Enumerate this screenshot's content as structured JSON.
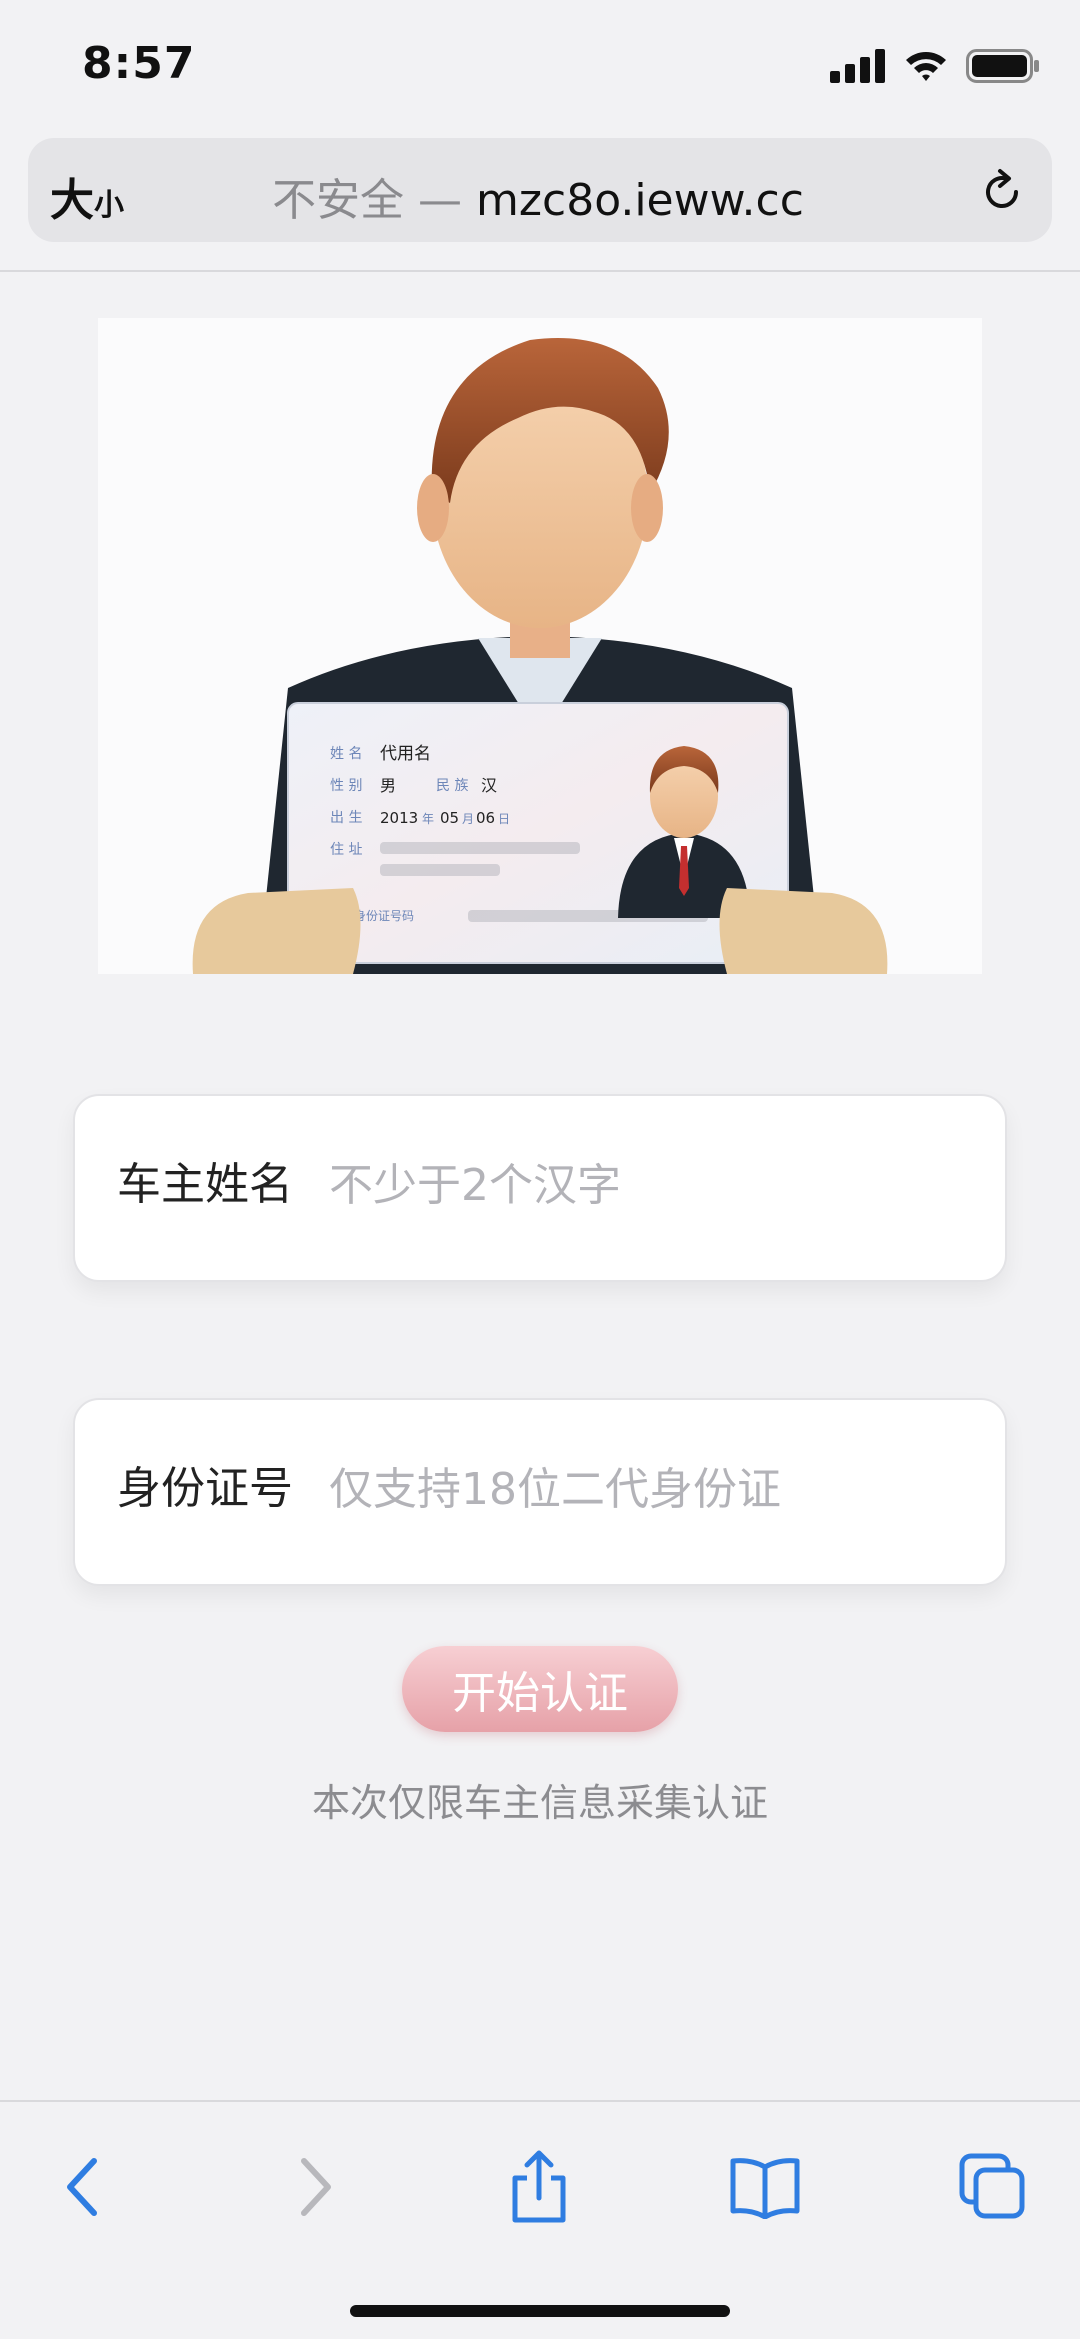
{
  "status_bar": {
    "time": "8:57"
  },
  "browser": {
    "text_size_large": "大",
    "text_size_small": "小",
    "security_label": "不安全",
    "separator": " — ",
    "domain": "mzc8o.ieww.cc"
  },
  "hero": {
    "card_name_label": "姓 名",
    "card_name_value": "代用名",
    "card_sex_label": "性 别",
    "card_sex_value": "男",
    "card_nation_label": "民 族",
    "card_nation_value": "汉",
    "card_birth_label": "出 生",
    "card_birth_year": "2013",
    "card_birth_year_unit": "年",
    "card_birth_month": "05",
    "card_birth_month_unit": "月",
    "card_birth_day": "06",
    "card_birth_day_unit": "日",
    "card_address_label": "住 址",
    "card_id_label": "公民身份证号码"
  },
  "form": {
    "name_label": "车主姓名",
    "name_placeholder": "不少于2个汉字",
    "id_label": "身份证号",
    "id_placeholder": "仅支持18位二代身份证",
    "submit_label": "开始认证",
    "notice": "本次仅限车主信息采集认证"
  },
  "colors": {
    "submit_button": "#e6a1a8",
    "toolbar_active": "#2f7de1",
    "toolbar_disabled": "#b8b8bc",
    "page_background": "#f2f2f4"
  },
  "toolbar": {
    "icons": [
      "back-icon",
      "forward-icon",
      "share-icon",
      "bookmarks-icon",
      "tabs-icon"
    ]
  }
}
